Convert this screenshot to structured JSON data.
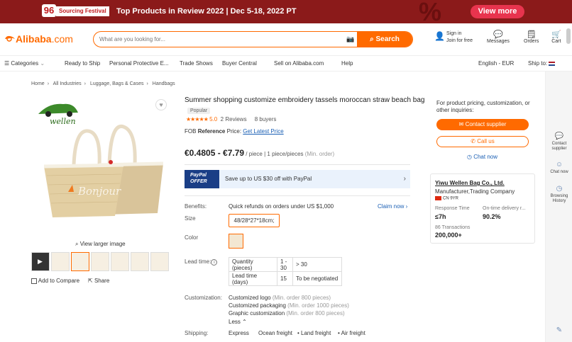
{
  "banner": {
    "badge": "96",
    "festival": "Sourcing Festival",
    "promo": "Top Products in Review 2022  |  Dec 5-18, 2022 PT",
    "deco": "%",
    "view_more": "View more"
  },
  "header": {
    "brand": "Alibaba",
    "brand_suffix": ".com",
    "search_placeholder": "What are you looking for...",
    "search_button": "Search",
    "signin_line1": "Sign in",
    "signin_line2": "Join for free",
    "messages": "Messages",
    "orders": "Orders",
    "cart": "Cart"
  },
  "nav": {
    "categories": "Categories",
    "items": [
      "Ready to Ship",
      "Personal Protective E...",
      "Trade Shows",
      "Buyer Central",
      "Sell on Alibaba.com",
      "Help"
    ],
    "language": "English - EUR",
    "ship_to": "Ship to:"
  },
  "breadcrumb": [
    "Home",
    "All Industries",
    "Luggage, Bags & Cases",
    "Handbags"
  ],
  "gallery": {
    "view_larger": "View larger image",
    "add_compare": "Add to Compare",
    "share": "Share",
    "logo_text": "wellen"
  },
  "product": {
    "title": "Summer shopping customize embroidery tassels moroccan straw beach bag",
    "popular": "Popular",
    "stars": "★★★★★",
    "score": "5.0",
    "reviews": "2 Reviews",
    "buyers": "8 buyers",
    "fob_label": "FOB",
    "fob_ref": "Reference",
    "fob_price_word": "Price:",
    "fob_link": "Get Latest Price",
    "price_range": "€0.4805 - €7.79",
    "price_unit": " / piece | 1 piece/pieces",
    "price_min": " (Min. order)",
    "paypal_badge_1": "PayPal",
    "paypal_badge_2": "OFFER",
    "paypal_text": "Save up to US $30 off with PayPal",
    "benefits_label": "Benefits:",
    "benefits_value": "Quick refunds on orders under US $1,000",
    "claim_now": "Claim now",
    "size_label": "Size",
    "size_value": "48/28*27*18cm;",
    "color_label": "Color",
    "lead_label": "Lead time:",
    "lead_table": [
      [
        "Quantity (pieces)",
        "1 - 30",
        "> 30"
      ],
      [
        "Lead time (days)",
        "15",
        "To be negotiated"
      ]
    ],
    "custom_label": "Customization:",
    "custom_items": [
      {
        "name": "Customized logo",
        "note": "(Min. order 800 pieces)"
      },
      {
        "name": "Customized packaging",
        "note": "(Min. order 1000 pieces)"
      },
      {
        "name": "Graphic customization",
        "note": "(Min. order 800 pieces)"
      }
    ],
    "less": "Less",
    "shipping_label": "Shipping:",
    "shipping_items": [
      "Express",
      "Ocean freight",
      "Land freight",
      "Air freight"
    ]
  },
  "inquiry": {
    "text": "For product pricing, customization, or other inquiries:",
    "contact": "Contact supplier",
    "call": "Call us",
    "chat": "Chat now"
  },
  "supplier": {
    "name": "Yiwu Wellen Bag Co., Ltd.",
    "type": "Manufacturer,Trading Company",
    "country": "CN",
    "years": "9YR",
    "response_label": "Response Time",
    "response_value": "≤7h",
    "ontime_label": "On-time delivery r...",
    "ontime_value": "90.2%",
    "transactions_label": "86 Transactions",
    "transactions_value": "200,000+"
  },
  "rail": {
    "contact": "Contact supplier",
    "chat": "Chat now",
    "history": "Browsing History"
  }
}
